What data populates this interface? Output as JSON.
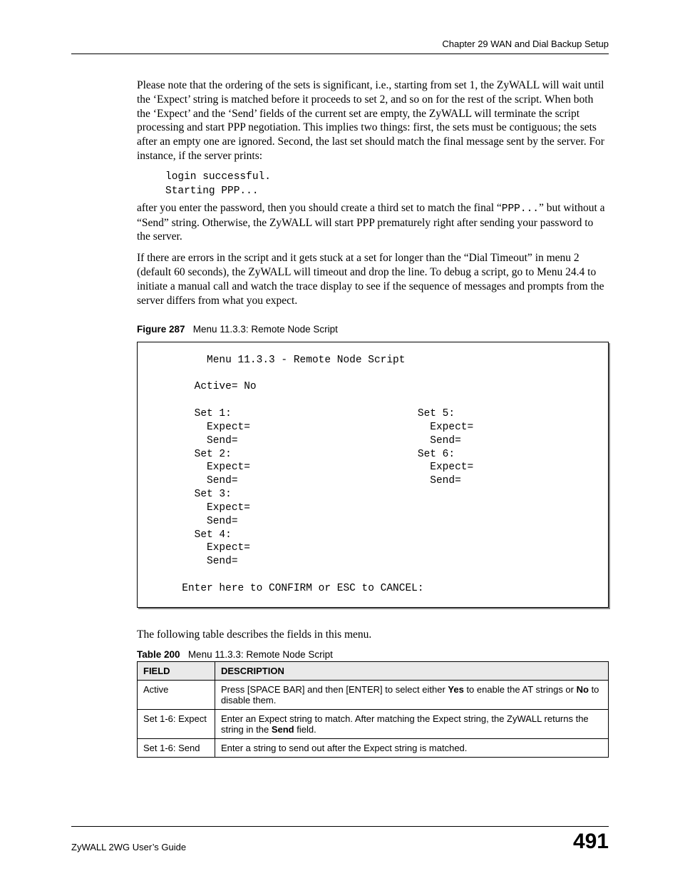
{
  "header": {
    "chapter": "Chapter 29 WAN and Dial Backup Setup"
  },
  "p1": "Please note that the ordering of the sets is significant, i.e., starting from set 1, the ZyWALL will wait until the ‘Expect’ string is matched before it proceeds to set 2, and so on for the rest of the script. When both the ‘Expect’ and the ‘Send’ fields of the current set are empty, the ZyWALL will terminate the script processing and start PPP negotiation. This implies two things: first, the sets must be contiguous; the sets after an empty one are ignored. Second, the last set should match the final message sent by the server. For instance, if the server prints:",
  "code1_l1": "login successful.",
  "code1_l2": "Starting PPP...",
  "p2_a": "after you enter the password, then you should create a third set to match the final “",
  "p2_mono": "PPP...",
  "p2_b": "” but without a “Send” string. Otherwise, the ZyWALL will start PPP prematurely right after sending your password to the server.",
  "p3": "If there are errors in the script and it gets stuck at a set for longer than the “Dial Timeout” in menu 2 (default 60 seconds), the ZyWALL will timeout and drop the line. To debug a script, go to Menu 24.4 to initiate a manual call and watch the trace display to see if the sequence of messages and prompts from the server differs from what you expect.",
  "fig": {
    "lead": "Figure 287",
    "title": "Menu 11.3.3: Remote Node Script"
  },
  "terminal": "          Menu 11.3.3 - Remote Node Script\n\n        Active= No\n\n        Set 1:                              Set 5:\n          Expect=                             Expect=\n          Send=                               Send=\n        Set 2:                              Set 6:\n          Expect=                             Expect=\n          Send=                               Send=\n        Set 3:\n          Expect=\n          Send=\n        Set 4:\n          Expect=\n          Send=\n\n      Enter here to CONFIRM or ESC to CANCEL:",
  "p4": "The following table describes the fields in this menu.",
  "tbl": {
    "lead": "Table 200",
    "title": "Menu 11.3.3: Remote Node Script",
    "head_field": "FIELD",
    "head_desc": "DESCRIPTION",
    "rows": [
      {
        "field": "Active",
        "desc_a": "Press [SPACE BAR] and then [ENTER] to select either ",
        "desc_b1": "Yes",
        "desc_c": " to enable the AT strings or ",
        "desc_b2": "No",
        "desc_d": " to disable them."
      },
      {
        "field": "Set 1-6: Expect",
        "desc_a": "Enter an Expect string to match. After matching the Expect string, the ZyWALL returns the string in the ",
        "desc_b1": "Send",
        "desc_c": " field.",
        "desc_b2": "",
        "desc_d": ""
      },
      {
        "field": "Set 1-6: Send",
        "desc_a": "Enter a string to send out after the Expect string is matched.",
        "desc_b1": "",
        "desc_c": "",
        "desc_b2": "",
        "desc_d": ""
      }
    ]
  },
  "footer": {
    "guide": "ZyWALL 2WG User’s Guide",
    "page": "491"
  }
}
